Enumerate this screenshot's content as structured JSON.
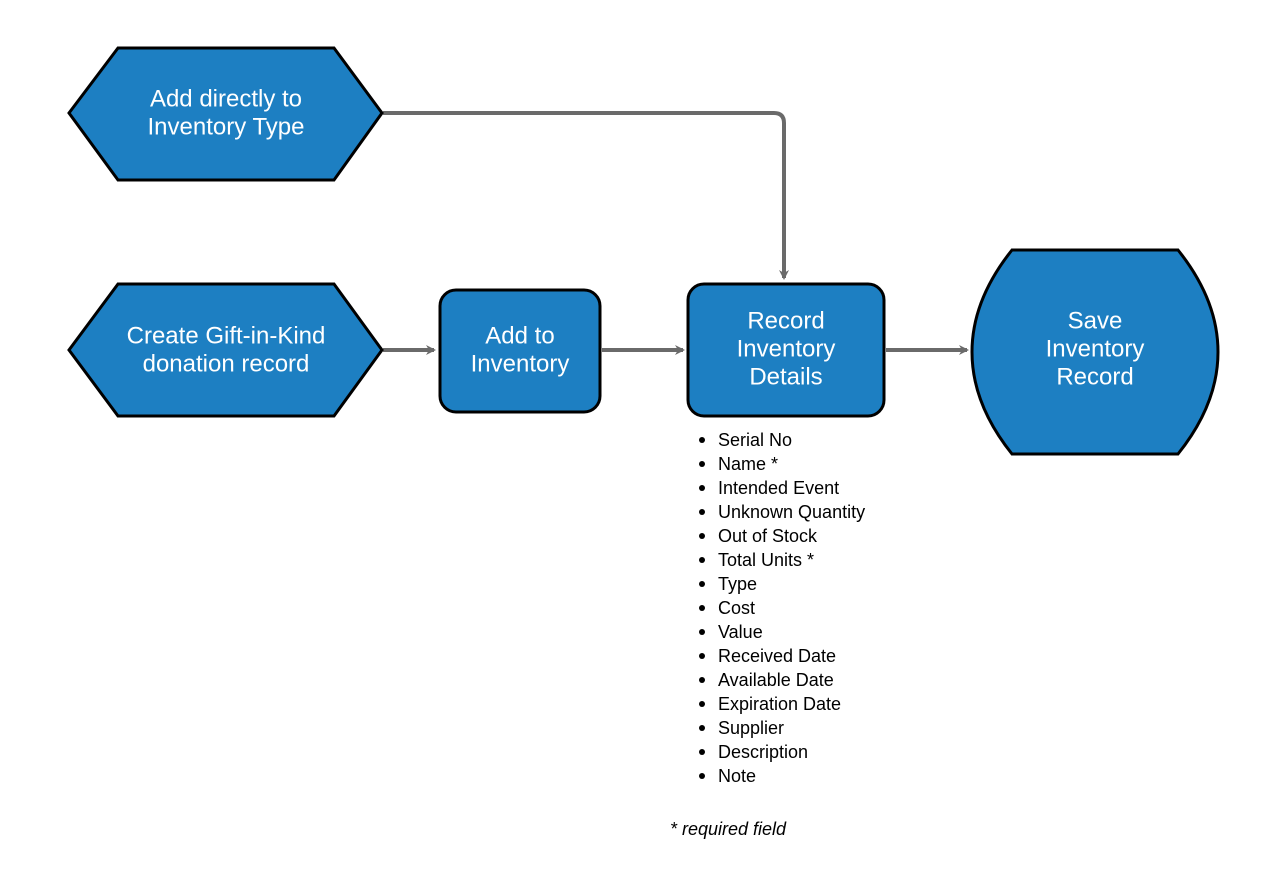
{
  "nodes": {
    "top_hex": {
      "line1": "Add directly to",
      "line2": "Inventory Type"
    },
    "left_hex": {
      "line1": "Create Gift-in-Kind",
      "line2": "donation record"
    },
    "add_inv": {
      "line1": "Add to",
      "line2": "Inventory"
    },
    "record_details": {
      "line1": "Record",
      "line2": "Inventory",
      "line3": "Details"
    },
    "save_record": {
      "line1": "Save",
      "line2": "Inventory",
      "line3": "Record"
    }
  },
  "details_list": [
    "Serial No",
    "Name *",
    "Intended Event",
    "Unknown Quantity",
    "Out of Stock",
    "Total Units *",
    "Type",
    "Cost",
    "Value",
    "Received Date",
    "Available Date",
    "Expiration Date",
    "Supplier",
    "Description",
    "Note"
  ],
  "footnote": "* required field",
  "colors": {
    "node_fill": "#1d7fc2",
    "node_stroke": "#000000",
    "arrow": "#6a6a6a"
  }
}
